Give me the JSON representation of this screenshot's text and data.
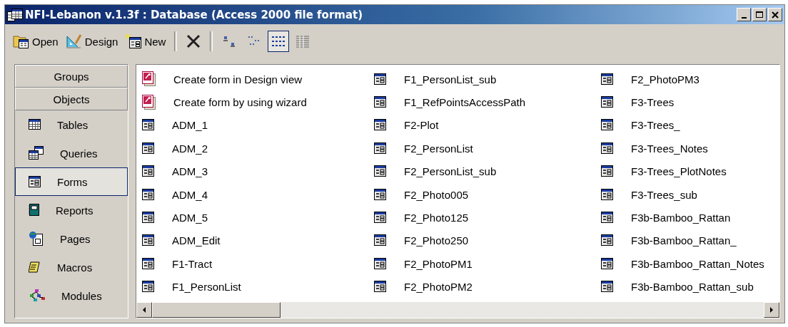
{
  "window": {
    "title": "NFI-Lebanon v.1.3f : Database (Access 2000 file format)"
  },
  "toolbar": {
    "actions": [
      {
        "kind": "open",
        "label": "Open"
      },
      {
        "kind": "design",
        "label": "Design"
      },
      {
        "kind": "new",
        "label": "New"
      },
      {
        "kind": "delete"
      }
    ],
    "views": [
      {
        "kind": "large",
        "selected": false
      },
      {
        "kind": "small",
        "selected": false
      },
      {
        "kind": "list",
        "selected": true
      },
      {
        "kind": "details",
        "selected": false
      }
    ]
  },
  "sidebar": {
    "headers": [
      "Groups",
      "Objects"
    ],
    "items": [
      {
        "kind": "table",
        "label": "Tables",
        "selected": false
      },
      {
        "kind": "query",
        "label": "Queries",
        "selected": false
      },
      {
        "kind": "form",
        "label": "Forms",
        "selected": true
      },
      {
        "kind": "report",
        "label": "Reports",
        "selected": false
      },
      {
        "kind": "page",
        "label": "Pages",
        "selected": false
      },
      {
        "kind": "macro",
        "label": "Macros",
        "selected": false
      },
      {
        "kind": "module",
        "label": "Modules",
        "selected": false
      }
    ]
  },
  "objects": [
    {
      "kind": "shortcut",
      "name": "Create form in Design view"
    },
    {
      "kind": "shortcut",
      "name": "Create form by using wizard"
    },
    {
      "kind": "form",
      "name": "ADM_1"
    },
    {
      "kind": "form",
      "name": "ADM_2"
    },
    {
      "kind": "form",
      "name": "ADM_3"
    },
    {
      "kind": "form",
      "name": "ADM_4"
    },
    {
      "kind": "form",
      "name": "ADM_5"
    },
    {
      "kind": "form",
      "name": "ADM_Edit"
    },
    {
      "kind": "form",
      "name": "F1-Tract"
    },
    {
      "kind": "form",
      "name": "F1_PersonList"
    },
    {
      "kind": "form",
      "name": "F1_PersonList_sub"
    },
    {
      "kind": "form",
      "name": "F1_RefPointsAccessPath"
    },
    {
      "kind": "form",
      "name": "F2-Plot"
    },
    {
      "kind": "form",
      "name": "F2_PersonList"
    },
    {
      "kind": "form",
      "name": "F2_PersonList_sub"
    },
    {
      "kind": "form",
      "name": "F2_Photo005"
    },
    {
      "kind": "form",
      "name": "F2_Photo125"
    },
    {
      "kind": "form",
      "name": "F2_Photo250"
    },
    {
      "kind": "form",
      "name": "F2_PhotoPM1"
    },
    {
      "kind": "form",
      "name": "F2_PhotoPM2"
    },
    {
      "kind": "form",
      "name": "F2_PhotoPM3"
    },
    {
      "kind": "form",
      "name": "F3-Trees"
    },
    {
      "kind": "form",
      "name": "F3-Trees_"
    },
    {
      "kind": "form",
      "name": "F3-Trees_Notes"
    },
    {
      "kind": "form",
      "name": "F3-Trees_PlotNotes"
    },
    {
      "kind": "form",
      "name": "F3-Trees_sub"
    },
    {
      "kind": "form",
      "name": "F3b-Bamboo_Rattan"
    },
    {
      "kind": "form",
      "name": "F3b-Bamboo_Rattan_"
    },
    {
      "kind": "form",
      "name": "F3b-Bamboo_Rattan_Notes"
    },
    {
      "kind": "form",
      "name": "F3b-Bamboo_Rattan_sub"
    }
  ]
}
